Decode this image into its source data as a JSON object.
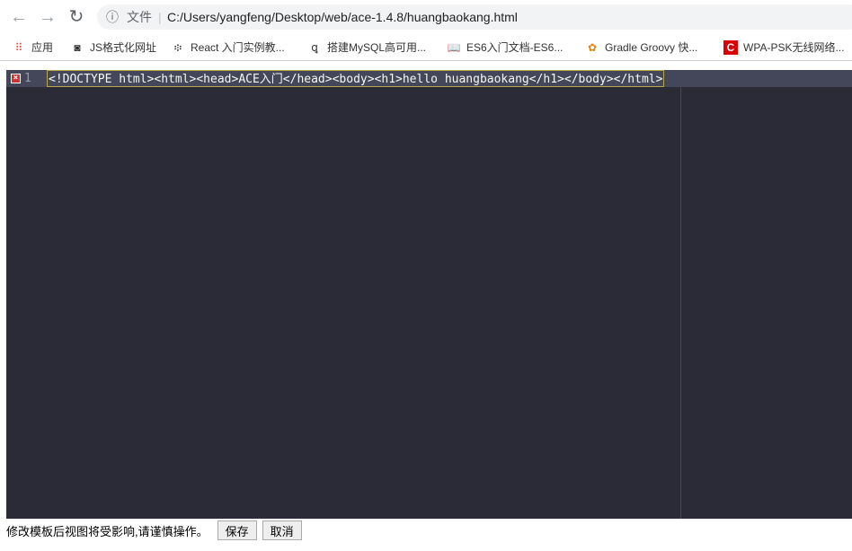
{
  "browser": {
    "url_label": "文件",
    "url": "C:/Users/yangfeng/Desktop/web/ace-1.4.8/huangbaokang.html"
  },
  "bookmarks": [
    {
      "label": "应用",
      "icon": "apps-grid-icon"
    },
    {
      "label": "JS格式化网址",
      "icon": "bookmark-icon"
    },
    {
      "label": "React 入门实例教...",
      "icon": "bookmark-icon"
    },
    {
      "label": "搭建MySQL高可用...",
      "icon": "bookmark-icon"
    },
    {
      "label": "ES6入门文档-ES6...",
      "icon": "book-icon"
    },
    {
      "label": "Gradle Groovy 快...",
      "icon": "bookmark-icon"
    },
    {
      "label": "WPA-PSK无线网络...",
      "icon": "bookmark-icon"
    }
  ],
  "editor": {
    "line_number": "1",
    "code": "<!DOCTYPE html><html><head>ACE入门</head><body><h1>hello huangbaokang</h1></body></html>"
  },
  "footer": {
    "warning": "修改模板后视图将受影响,请谨慎操作。",
    "save": "保存",
    "cancel": "取消"
  }
}
